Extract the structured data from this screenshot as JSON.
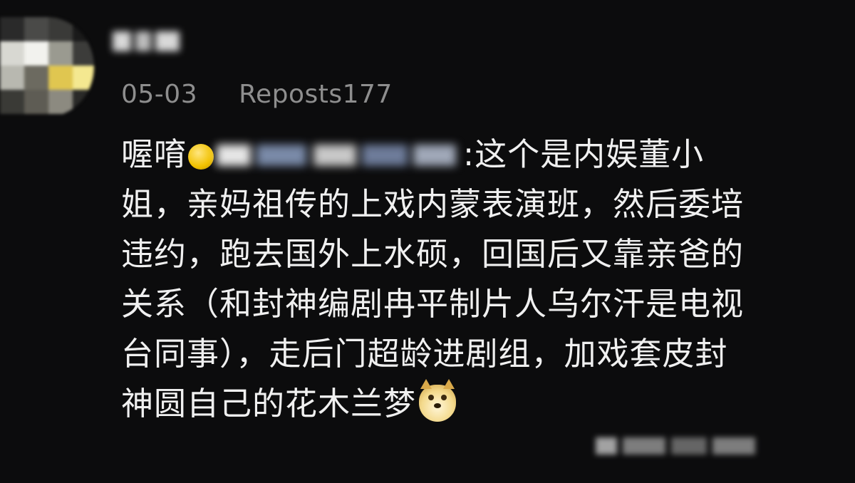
{
  "post": {
    "date": "05-03",
    "reposts": "Reposts177"
  },
  "comment": {
    "prefix": "喔唷",
    "after_mention": ":这个是内娱董小",
    "lines": [
      "姐，亲妈祖传的上戏内蒙表演班，然后委培",
      "违约，跑去国外上水硕，回国后又靠亲爸的",
      "关系（和封神编剧冉平制片人乌尔汗是电视",
      "台同事），走后门超龄进剧组，加戏套皮封"
    ],
    "last_line": "神圆自己的花木兰梦"
  },
  "icons": {
    "mention_emoji": "yellow-face-emoji",
    "doge_emoji": "doge-emoji"
  },
  "colors": {
    "background": "#0c0c0d",
    "text": "#f0f0f0",
    "meta_text": "#8e8e8e"
  }
}
